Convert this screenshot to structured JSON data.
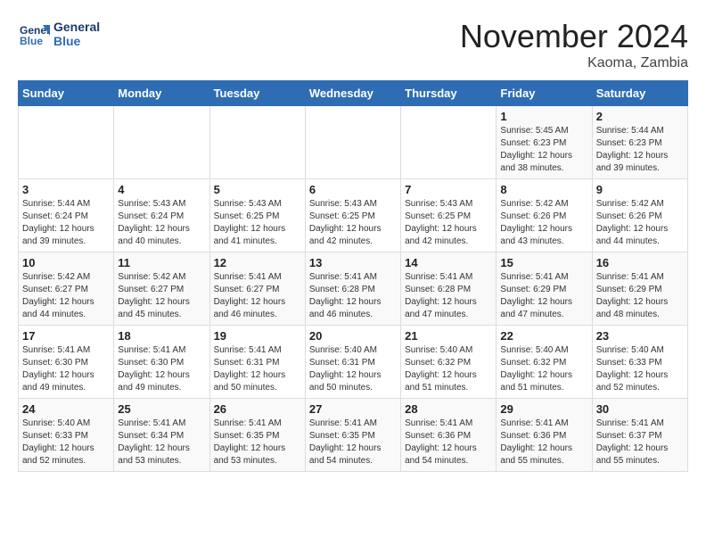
{
  "header": {
    "logo_line1": "General",
    "logo_line2": "Blue",
    "month": "November 2024",
    "location": "Kaoma, Zambia"
  },
  "weekdays": [
    "Sunday",
    "Monday",
    "Tuesday",
    "Wednesday",
    "Thursday",
    "Friday",
    "Saturday"
  ],
  "weeks": [
    [
      {
        "day": "",
        "info": ""
      },
      {
        "day": "",
        "info": ""
      },
      {
        "day": "",
        "info": ""
      },
      {
        "day": "",
        "info": ""
      },
      {
        "day": "",
        "info": ""
      },
      {
        "day": "1",
        "info": "Sunrise: 5:45 AM\nSunset: 6:23 PM\nDaylight: 12 hours\nand 38 minutes."
      },
      {
        "day": "2",
        "info": "Sunrise: 5:44 AM\nSunset: 6:23 PM\nDaylight: 12 hours\nand 39 minutes."
      }
    ],
    [
      {
        "day": "3",
        "info": "Sunrise: 5:44 AM\nSunset: 6:24 PM\nDaylight: 12 hours\nand 39 minutes."
      },
      {
        "day": "4",
        "info": "Sunrise: 5:43 AM\nSunset: 6:24 PM\nDaylight: 12 hours\nand 40 minutes."
      },
      {
        "day": "5",
        "info": "Sunrise: 5:43 AM\nSunset: 6:25 PM\nDaylight: 12 hours\nand 41 minutes."
      },
      {
        "day": "6",
        "info": "Sunrise: 5:43 AM\nSunset: 6:25 PM\nDaylight: 12 hours\nand 42 minutes."
      },
      {
        "day": "7",
        "info": "Sunrise: 5:43 AM\nSunset: 6:25 PM\nDaylight: 12 hours\nand 42 minutes."
      },
      {
        "day": "8",
        "info": "Sunrise: 5:42 AM\nSunset: 6:26 PM\nDaylight: 12 hours\nand 43 minutes."
      },
      {
        "day": "9",
        "info": "Sunrise: 5:42 AM\nSunset: 6:26 PM\nDaylight: 12 hours\nand 44 minutes."
      }
    ],
    [
      {
        "day": "10",
        "info": "Sunrise: 5:42 AM\nSunset: 6:27 PM\nDaylight: 12 hours\nand 44 minutes."
      },
      {
        "day": "11",
        "info": "Sunrise: 5:42 AM\nSunset: 6:27 PM\nDaylight: 12 hours\nand 45 minutes."
      },
      {
        "day": "12",
        "info": "Sunrise: 5:41 AM\nSunset: 6:27 PM\nDaylight: 12 hours\nand 46 minutes."
      },
      {
        "day": "13",
        "info": "Sunrise: 5:41 AM\nSunset: 6:28 PM\nDaylight: 12 hours\nand 46 minutes."
      },
      {
        "day": "14",
        "info": "Sunrise: 5:41 AM\nSunset: 6:28 PM\nDaylight: 12 hours\nand 47 minutes."
      },
      {
        "day": "15",
        "info": "Sunrise: 5:41 AM\nSunset: 6:29 PM\nDaylight: 12 hours\nand 47 minutes."
      },
      {
        "day": "16",
        "info": "Sunrise: 5:41 AM\nSunset: 6:29 PM\nDaylight: 12 hours\nand 48 minutes."
      }
    ],
    [
      {
        "day": "17",
        "info": "Sunrise: 5:41 AM\nSunset: 6:30 PM\nDaylight: 12 hours\nand 49 minutes."
      },
      {
        "day": "18",
        "info": "Sunrise: 5:41 AM\nSunset: 6:30 PM\nDaylight: 12 hours\nand 49 minutes."
      },
      {
        "day": "19",
        "info": "Sunrise: 5:41 AM\nSunset: 6:31 PM\nDaylight: 12 hours\nand 50 minutes."
      },
      {
        "day": "20",
        "info": "Sunrise: 5:40 AM\nSunset: 6:31 PM\nDaylight: 12 hours\nand 50 minutes."
      },
      {
        "day": "21",
        "info": "Sunrise: 5:40 AM\nSunset: 6:32 PM\nDaylight: 12 hours\nand 51 minutes."
      },
      {
        "day": "22",
        "info": "Sunrise: 5:40 AM\nSunset: 6:32 PM\nDaylight: 12 hours\nand 51 minutes."
      },
      {
        "day": "23",
        "info": "Sunrise: 5:40 AM\nSunset: 6:33 PM\nDaylight: 12 hours\nand 52 minutes."
      }
    ],
    [
      {
        "day": "24",
        "info": "Sunrise: 5:40 AM\nSunset: 6:33 PM\nDaylight: 12 hours\nand 52 minutes."
      },
      {
        "day": "25",
        "info": "Sunrise: 5:41 AM\nSunset: 6:34 PM\nDaylight: 12 hours\nand 53 minutes."
      },
      {
        "day": "26",
        "info": "Sunrise: 5:41 AM\nSunset: 6:35 PM\nDaylight: 12 hours\nand 53 minutes."
      },
      {
        "day": "27",
        "info": "Sunrise: 5:41 AM\nSunset: 6:35 PM\nDaylight: 12 hours\nand 54 minutes."
      },
      {
        "day": "28",
        "info": "Sunrise: 5:41 AM\nSunset: 6:36 PM\nDaylight: 12 hours\nand 54 minutes."
      },
      {
        "day": "29",
        "info": "Sunrise: 5:41 AM\nSunset: 6:36 PM\nDaylight: 12 hours\nand 55 minutes."
      },
      {
        "day": "30",
        "info": "Sunrise: 5:41 AM\nSunset: 6:37 PM\nDaylight: 12 hours\nand 55 minutes."
      }
    ]
  ]
}
